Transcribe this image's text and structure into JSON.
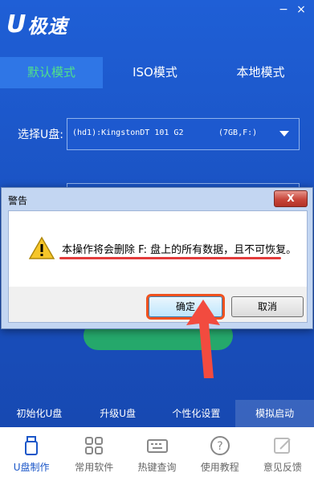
{
  "app": {
    "logo_u": "U",
    "logo_rest": "极速"
  },
  "window_controls": {
    "minimize": "−",
    "close": "×"
  },
  "tabs": [
    {
      "label": "默认模式",
      "active": true
    },
    {
      "label": "ISO模式",
      "active": false
    },
    {
      "label": "本地模式",
      "active": false
    }
  ],
  "select_udisk": {
    "label": "选择U盘:",
    "value_name": "(hd1):KingstonDT 101 G2",
    "value_size": "(7GB,F:)"
  },
  "function_bar": [
    {
      "label": "初始化U盘"
    },
    {
      "label": "升级U盘"
    },
    {
      "label": "个性化设置"
    },
    {
      "label": "模拟启动"
    }
  ],
  "bottom_nav": [
    {
      "label": "U盘制作",
      "icon": "usb-icon",
      "active": true
    },
    {
      "label": "常用软件",
      "icon": "apps-grid-icon",
      "active": false
    },
    {
      "label": "热键查询",
      "icon": "keyboard-icon",
      "active": false
    },
    {
      "label": "使用教程",
      "icon": "help-icon",
      "active": false
    },
    {
      "label": "意见反馈",
      "icon": "edit-icon",
      "active": false
    }
  ],
  "dialog": {
    "title": "警告",
    "close_label": "X",
    "message": "本操作将会删除 F: 盘上的所有数据，且不可恢复。",
    "ok_label": "确定",
    "cancel_label": "取消"
  },
  "colors": {
    "background": "#1a56c8",
    "active_tab_text": "#4fe08a",
    "start_button": "#25a86b",
    "annotation_red": "#e23b3b",
    "annotation_orange": "#f0521f"
  }
}
